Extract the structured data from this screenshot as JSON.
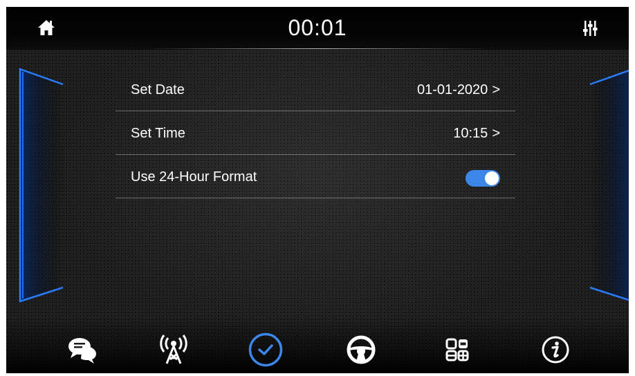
{
  "header": {
    "time": "00:01",
    "home_icon": "home-icon",
    "equalizer_icon": "equalizer-icon"
  },
  "settings": [
    {
      "label": "Set Date",
      "value": "01-01-2020",
      "chevron": ">"
    },
    {
      "label": "Set Time",
      "value": "10:15",
      "chevron": ">"
    },
    {
      "label": "Use 24-Hour Format",
      "toggle_on": true
    }
  ],
  "dock": [
    {
      "icon": "chat-bubbles-icon",
      "active": false
    },
    {
      "icon": "antenna-icon",
      "active": false
    },
    {
      "icon": "clock-icon",
      "active": true
    },
    {
      "icon": "steering-wheel-icon",
      "active": false
    },
    {
      "icon": "apps-grid-icon",
      "active": false
    },
    {
      "icon": "info-icon",
      "active": false
    }
  ],
  "colors": {
    "accent": "#3b86e8",
    "panel_glow": "#1e6fff",
    "text": "#ffffff"
  }
}
